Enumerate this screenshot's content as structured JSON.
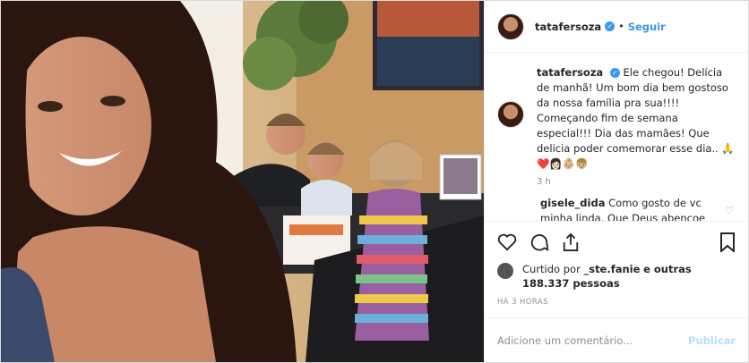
{
  "post": {
    "username": "tatafersoza",
    "follow_label": "Seguir",
    "dot": "•",
    "caption_user": "tatafersoza",
    "caption_text": "Ele chegou! Delícia de manhã! Um bom dia bem gostoso da nossa família pra sua!!!! Começando fim de semana especial!!! Dia das mamães! Que delicia poder comemorar esse dia.. 🙏❤️👩🏻👶🏼👦🏼",
    "caption_time": "3 h",
    "comment_user": "gisele_dida",
    "comment_text": "Como gosto de vc minha linda. Que Deus abençoe",
    "liked_by_prefix": "Curtido por",
    "liked_by_user": "_ste.fanie",
    "liked_by_rest": "e outras 188.337 pessoas",
    "time_ago": "HÁ 3 HORAS",
    "comment_placeholder": "Adicione um comentário...",
    "publish_label": "Publicar"
  },
  "colors": {
    "link": "#3897f0",
    "publish_disabled": "#b2dffc",
    "muted": "#8e8e8e"
  },
  "icons": [
    "heart-icon",
    "comment-icon",
    "share-icon",
    "bookmark-icon",
    "verified-icon"
  ]
}
